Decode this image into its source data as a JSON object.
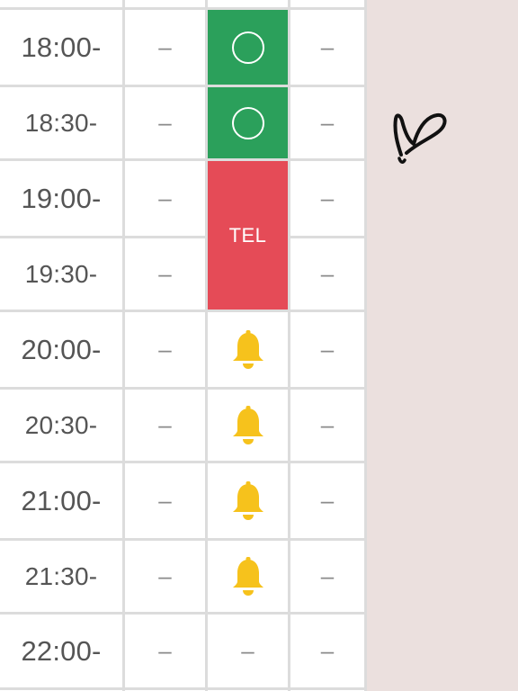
{
  "rows": [
    {
      "time": "18:00-",
      "col1": "–",
      "col2": "",
      "col3": "–"
    },
    {
      "time": "18:30-",
      "col1": "–",
      "col2": "",
      "col3": "–"
    },
    {
      "time": "19:00-",
      "col1": "–",
      "col2": "",
      "col3": "–"
    },
    {
      "time": "19:30-",
      "col1": "–",
      "col2": "",
      "col3": "–"
    },
    {
      "time": "20:00-",
      "col1": "–",
      "col2": "",
      "col3": "–"
    },
    {
      "time": "20:30-",
      "col1": "–",
      "col2": "",
      "col3": "–"
    },
    {
      "time": "21:00-",
      "col1": "–",
      "col2": "",
      "col3": "–"
    },
    {
      "time": "21:30-",
      "col1": "–",
      "col2": "",
      "col3": "–"
    },
    {
      "time": "22:00-",
      "col1": "–",
      "col2": "–",
      "col3": "–"
    }
  ],
  "slots": {
    "tel_label": "TEL",
    "available_icon": "circle-icon",
    "bell_icon": "bell-icon"
  },
  "colors": {
    "available": "#2ba05b",
    "tel": "#e54b57",
    "bell": "#f6c21c",
    "background": "#ebe0de"
  },
  "decoration": {
    "heart_icon": "heart-doodle-icon"
  }
}
